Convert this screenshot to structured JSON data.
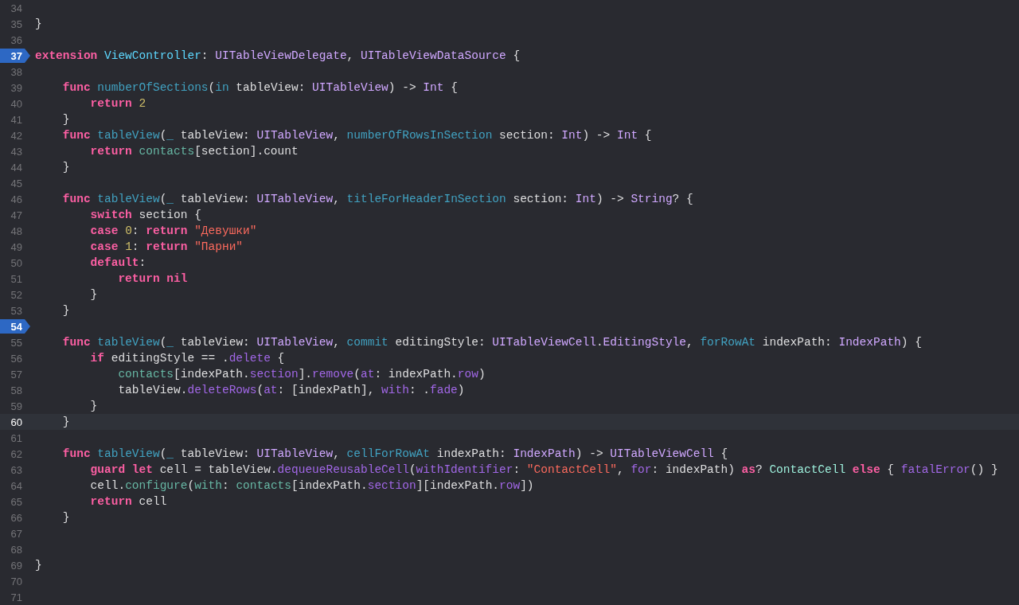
{
  "lines": [
    {
      "number": "34",
      "breakpoint": false,
      "current": false
    },
    {
      "number": "35",
      "breakpoint": false,
      "current": false,
      "tokens": [
        {
          "text": "}",
          "kind": "plain"
        }
      ]
    },
    {
      "number": "36",
      "breakpoint": false,
      "current": false
    },
    {
      "number": "37",
      "breakpoint": true,
      "current": false,
      "tokens": [
        {
          "text": "extension ",
          "kind": "keyword"
        },
        {
          "text": "ViewController",
          "kind": "declared-type"
        },
        {
          "text": ": ",
          "kind": "plain"
        },
        {
          "text": "UITableViewDelegate",
          "kind": "type"
        },
        {
          "text": ", ",
          "kind": "plain"
        },
        {
          "text": "UITableViewDataSource",
          "kind": "type"
        },
        {
          "text": " {",
          "kind": "plain"
        }
      ]
    },
    {
      "number": "38",
      "breakpoint": false,
      "current": false
    },
    {
      "number": "39",
      "breakpoint": false,
      "current": false,
      "tokens": [
        {
          "text": "    func ",
          "kind": "keyword"
        },
        {
          "text": "numberOfSections",
          "kind": "declaration"
        },
        {
          "text": "(",
          "kind": "plain"
        },
        {
          "text": "in",
          "kind": "declaration"
        },
        {
          "text": " tableView: ",
          "kind": "plain"
        },
        {
          "text": "UITableView",
          "kind": "type"
        },
        {
          "text": ") -> ",
          "kind": "plain"
        },
        {
          "text": "Int",
          "kind": "type"
        },
        {
          "text": " {",
          "kind": "plain"
        }
      ]
    },
    {
      "number": "40",
      "breakpoint": false,
      "current": false,
      "tokens": [
        {
          "text": "        return ",
          "kind": "keyword"
        },
        {
          "text": "2",
          "kind": "number"
        }
      ]
    },
    {
      "number": "41",
      "breakpoint": false,
      "current": false,
      "tokens": [
        {
          "text": "    }",
          "kind": "plain"
        }
      ]
    },
    {
      "number": "42",
      "breakpoint": false,
      "current": false,
      "tokens": [
        {
          "text": "    func ",
          "kind": "keyword"
        },
        {
          "text": "tableView",
          "kind": "declaration"
        },
        {
          "text": "(",
          "kind": "plain"
        },
        {
          "text": "_",
          "kind": "declaration"
        },
        {
          "text": " tableView: ",
          "kind": "plain"
        },
        {
          "text": "UITableView",
          "kind": "type"
        },
        {
          "text": ", ",
          "kind": "plain"
        },
        {
          "text": "numberOfRowsInSection",
          "kind": "declaration"
        },
        {
          "text": " section: ",
          "kind": "plain"
        },
        {
          "text": "Int",
          "kind": "type"
        },
        {
          "text": ") -> ",
          "kind": "plain"
        },
        {
          "text": "Int",
          "kind": "type"
        },
        {
          "text": " {",
          "kind": "plain"
        }
      ]
    },
    {
      "number": "43",
      "breakpoint": false,
      "current": false,
      "tokens": [
        {
          "text": "        return ",
          "kind": "keyword"
        },
        {
          "text": "contacts",
          "kind": "project-member"
        },
        {
          "text": "[section].count",
          "kind": "plain"
        }
      ]
    },
    {
      "number": "44",
      "breakpoint": false,
      "current": false,
      "tokens": [
        {
          "text": "    }",
          "kind": "plain"
        }
      ]
    },
    {
      "number": "45",
      "breakpoint": false,
      "current": false
    },
    {
      "number": "46",
      "breakpoint": false,
      "current": false,
      "tokens": [
        {
          "text": "    func ",
          "kind": "keyword"
        },
        {
          "text": "tableView",
          "kind": "declaration"
        },
        {
          "text": "(",
          "kind": "plain"
        },
        {
          "text": "_",
          "kind": "declaration"
        },
        {
          "text": " tableView: ",
          "kind": "plain"
        },
        {
          "text": "UITableView",
          "kind": "type"
        },
        {
          "text": ", ",
          "kind": "plain"
        },
        {
          "text": "titleForHeaderInSection",
          "kind": "declaration"
        },
        {
          "text": " section: ",
          "kind": "plain"
        },
        {
          "text": "Int",
          "kind": "type"
        },
        {
          "text": ") -> ",
          "kind": "plain"
        },
        {
          "text": "String",
          "kind": "type"
        },
        {
          "text": "? {",
          "kind": "plain"
        }
      ]
    },
    {
      "number": "47",
      "breakpoint": false,
      "current": false,
      "tokens": [
        {
          "text": "        switch",
          "kind": "keyword"
        },
        {
          "text": " section {",
          "kind": "plain"
        }
      ]
    },
    {
      "number": "48",
      "breakpoint": false,
      "current": false,
      "tokens": [
        {
          "text": "        case ",
          "kind": "keyword"
        },
        {
          "text": "0",
          "kind": "number"
        },
        {
          "text": ": ",
          "kind": "plain"
        },
        {
          "text": "return ",
          "kind": "keyword"
        },
        {
          "text": "\"Девушки\"",
          "kind": "string"
        }
      ]
    },
    {
      "number": "49",
      "breakpoint": false,
      "current": false,
      "tokens": [
        {
          "text": "        case ",
          "kind": "keyword"
        },
        {
          "text": "1",
          "kind": "number"
        },
        {
          "text": ": ",
          "kind": "plain"
        },
        {
          "text": "return ",
          "kind": "keyword"
        },
        {
          "text": "\"Парни\"",
          "kind": "string"
        }
      ]
    },
    {
      "number": "50",
      "breakpoint": false,
      "current": false,
      "tokens": [
        {
          "text": "        default",
          "kind": "keyword"
        },
        {
          "text": ":",
          "kind": "plain"
        }
      ]
    },
    {
      "number": "51",
      "breakpoint": false,
      "current": false,
      "tokens": [
        {
          "text": "            return nil",
          "kind": "keyword"
        }
      ]
    },
    {
      "number": "52",
      "breakpoint": false,
      "current": false,
      "tokens": [
        {
          "text": "        }",
          "kind": "plain"
        }
      ]
    },
    {
      "number": "53",
      "breakpoint": false,
      "current": false,
      "tokens": [
        {
          "text": "    }",
          "kind": "plain"
        }
      ]
    },
    {
      "number": "54",
      "breakpoint": true,
      "current": false
    },
    {
      "number": "55",
      "breakpoint": false,
      "current": false,
      "tokens": [
        {
          "text": "    func ",
          "kind": "keyword"
        },
        {
          "text": "tableView",
          "kind": "declaration"
        },
        {
          "text": "(",
          "kind": "plain"
        },
        {
          "text": "_",
          "kind": "declaration"
        },
        {
          "text": " tableView: ",
          "kind": "plain"
        },
        {
          "text": "UITableView",
          "kind": "type"
        },
        {
          "text": ", ",
          "kind": "plain"
        },
        {
          "text": "commit",
          "kind": "declaration"
        },
        {
          "text": " editingStyle: ",
          "kind": "plain"
        },
        {
          "text": "UITableViewCell",
          "kind": "type"
        },
        {
          "text": ".",
          "kind": "plain"
        },
        {
          "text": "EditingStyle",
          "kind": "type"
        },
        {
          "text": ", ",
          "kind": "plain"
        },
        {
          "text": "forRowAt",
          "kind": "declaration"
        },
        {
          "text": " indexPath: ",
          "kind": "plain"
        },
        {
          "text": "IndexPath",
          "kind": "type"
        },
        {
          "text": ") {",
          "kind": "plain"
        }
      ]
    },
    {
      "number": "56",
      "breakpoint": false,
      "current": false,
      "tokens": [
        {
          "text": "        if",
          "kind": "keyword"
        },
        {
          "text": " editingStyle == .",
          "kind": "plain"
        },
        {
          "text": "delete",
          "kind": "system-member"
        },
        {
          "text": " {",
          "kind": "plain"
        }
      ]
    },
    {
      "number": "57",
      "breakpoint": false,
      "current": false,
      "tokens": [
        {
          "text": "            contacts",
          "kind": "project-member"
        },
        {
          "text": "[indexPath.",
          "kind": "plain"
        },
        {
          "text": "section",
          "kind": "system-member"
        },
        {
          "text": "].",
          "kind": "plain"
        },
        {
          "text": "remove",
          "kind": "system-member"
        },
        {
          "text": "(",
          "kind": "plain"
        },
        {
          "text": "at",
          "kind": "system-member"
        },
        {
          "text": ": indexPath.",
          "kind": "plain"
        },
        {
          "text": "row",
          "kind": "system-member"
        },
        {
          "text": ")",
          "kind": "plain"
        }
      ]
    },
    {
      "number": "58",
      "breakpoint": false,
      "current": false,
      "tokens": [
        {
          "text": "            tableView.",
          "kind": "plain"
        },
        {
          "text": "deleteRows",
          "kind": "system-member"
        },
        {
          "text": "(",
          "kind": "plain"
        },
        {
          "text": "at",
          "kind": "system-member"
        },
        {
          "text": ": [indexPath], ",
          "kind": "plain"
        },
        {
          "text": "with",
          "kind": "system-member"
        },
        {
          "text": ": .",
          "kind": "plain"
        },
        {
          "text": "fade",
          "kind": "system-member"
        },
        {
          "text": ")",
          "kind": "plain"
        }
      ]
    },
    {
      "number": "59",
      "breakpoint": false,
      "current": false,
      "tokens": [
        {
          "text": "        }",
          "kind": "plain"
        }
      ]
    },
    {
      "number": "60",
      "breakpoint": false,
      "current": true,
      "tokens": [
        {
          "text": "    }",
          "kind": "plain"
        }
      ]
    },
    {
      "number": "61",
      "breakpoint": false,
      "current": false
    },
    {
      "number": "62",
      "breakpoint": false,
      "current": false,
      "tokens": [
        {
          "text": "    func ",
          "kind": "keyword"
        },
        {
          "text": "tableView",
          "kind": "declaration"
        },
        {
          "text": "(",
          "kind": "plain"
        },
        {
          "text": "_",
          "kind": "declaration"
        },
        {
          "text": " tableView: ",
          "kind": "plain"
        },
        {
          "text": "UITableView",
          "kind": "type"
        },
        {
          "text": ", ",
          "kind": "plain"
        },
        {
          "text": "cellForRowAt",
          "kind": "declaration"
        },
        {
          "text": " indexPath: ",
          "kind": "plain"
        },
        {
          "text": "IndexPath",
          "kind": "type"
        },
        {
          "text": ") -> ",
          "kind": "plain"
        },
        {
          "text": "UITableViewCell",
          "kind": "type"
        },
        {
          "text": " {",
          "kind": "plain"
        }
      ]
    },
    {
      "number": "63",
      "breakpoint": false,
      "current": false,
      "tokens": [
        {
          "text": "        guard let",
          "kind": "keyword"
        },
        {
          "text": " cell = tableView.",
          "kind": "plain"
        },
        {
          "text": "dequeueReusableCell",
          "kind": "system-member"
        },
        {
          "text": "(",
          "kind": "plain"
        },
        {
          "text": "withIdentifier",
          "kind": "system-member"
        },
        {
          "text": ": ",
          "kind": "plain"
        },
        {
          "text": "\"ContactCell\"",
          "kind": "string"
        },
        {
          "text": ", ",
          "kind": "plain"
        },
        {
          "text": "for",
          "kind": "system-member"
        },
        {
          "text": ": indexPath) ",
          "kind": "plain"
        },
        {
          "text": "as",
          "kind": "keyword"
        },
        {
          "text": "? ",
          "kind": "plain"
        },
        {
          "text": "ContactCell ",
          "kind": "project-type"
        },
        {
          "text": "else",
          "kind": "keyword"
        },
        {
          "text": " { ",
          "kind": "plain"
        },
        {
          "text": "fatalError",
          "kind": "system-member"
        },
        {
          "text": "() }",
          "kind": "plain"
        }
      ]
    },
    {
      "number": "64",
      "breakpoint": false,
      "current": false,
      "tokens": [
        {
          "text": "        cell.",
          "kind": "plain"
        },
        {
          "text": "configure",
          "kind": "project-member"
        },
        {
          "text": "(",
          "kind": "plain"
        },
        {
          "text": "with",
          "kind": "project-member"
        },
        {
          "text": ": ",
          "kind": "plain"
        },
        {
          "text": "contacts",
          "kind": "project-member"
        },
        {
          "text": "[indexPath.",
          "kind": "plain"
        },
        {
          "text": "section",
          "kind": "system-member"
        },
        {
          "text": "][indexPath.",
          "kind": "plain"
        },
        {
          "text": "row",
          "kind": "system-member"
        },
        {
          "text": "])",
          "kind": "plain"
        }
      ]
    },
    {
      "number": "65",
      "breakpoint": false,
      "current": false,
      "tokens": [
        {
          "text": "        return",
          "kind": "keyword"
        },
        {
          "text": " cell",
          "kind": "plain"
        }
      ]
    },
    {
      "number": "66",
      "breakpoint": false,
      "current": false,
      "tokens": [
        {
          "text": "    }",
          "kind": "plain"
        }
      ]
    },
    {
      "number": "67",
      "breakpoint": false,
      "current": false
    },
    {
      "number": "68",
      "breakpoint": false,
      "current": false
    },
    {
      "number": "69",
      "breakpoint": false,
      "current": false,
      "tokens": [
        {
          "text": "}",
          "kind": "plain"
        }
      ]
    },
    {
      "number": "70",
      "breakpoint": false,
      "current": false
    },
    {
      "number": "71",
      "breakpoint": false,
      "current": false
    }
  ]
}
